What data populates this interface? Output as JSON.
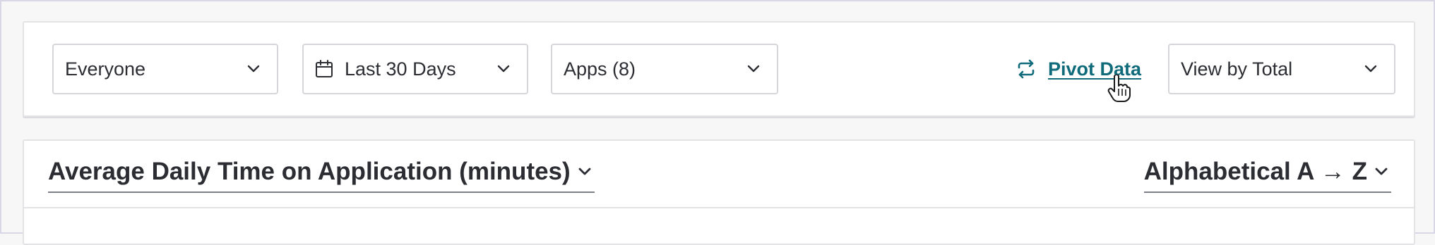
{
  "filters": {
    "audience": {
      "value": "Everyone"
    },
    "date_range": {
      "value": "Last 30 Days"
    },
    "apps": {
      "value": "Apps (8)"
    },
    "pivot": {
      "label": "Pivot Data"
    },
    "view": {
      "value": "View by Total"
    }
  },
  "chart_header": {
    "metric": "Average Daily Time on Application (minutes)",
    "sort": "Alphabetical A → Z"
  },
  "colors": {
    "link": "#0f6a7a",
    "text": "#2b2d33",
    "border": "#d6d6da",
    "background": "#f7f7f8"
  },
  "icons": {
    "dropdown": "chevron-down-icon",
    "date": "calendar-icon",
    "pivot": "swap-arrows-icon",
    "cursor": "hand-pointer-icon"
  }
}
